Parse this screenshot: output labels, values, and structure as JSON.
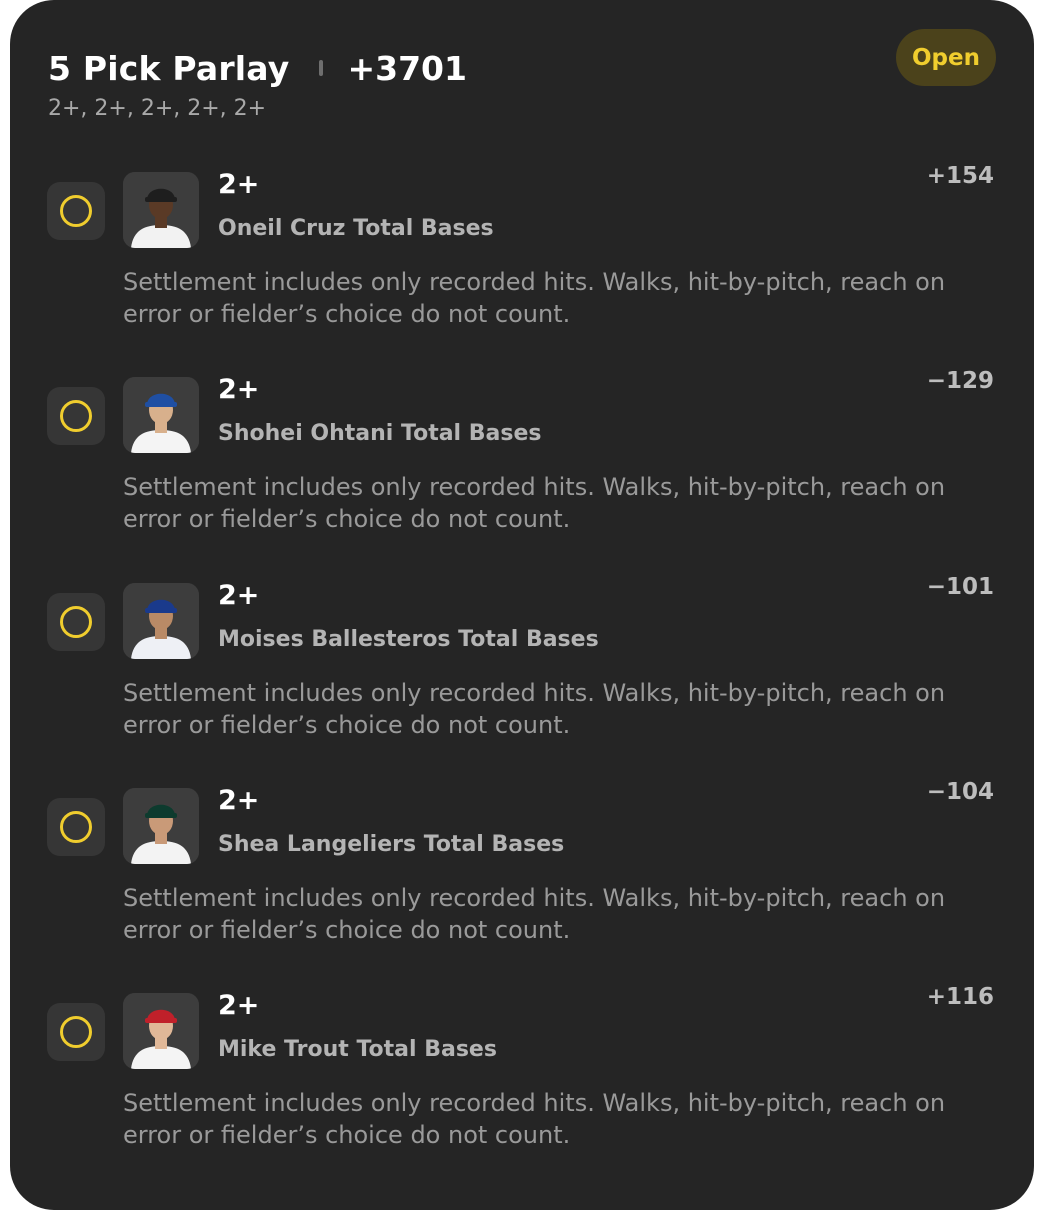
{
  "parlay": {
    "title": "5 Pick Parlay",
    "odds": "+3701",
    "lines_summary": "2+, 2+, 2+, 2+, 2+",
    "status": "Open"
  },
  "picks": [
    {
      "line": "2+",
      "market": "Oneil Cruz Total Bases",
      "odds": "+154",
      "description": "Settlement includes only recorded hits. Walks, hit-by-pitch, reach on error or fielder’s choice do not count.",
      "cap_color": "#1e1e1e",
      "jersey_color": "#f2f2f2",
      "skin_color": "#5a3a26"
    },
    {
      "line": "2+",
      "market": "Shohei Ohtani Total Bases",
      "odds": "−129",
      "description": "Settlement includes only recorded hits. Walks, hit-by-pitch, reach on error or fielder’s choice do not count.",
      "cap_color": "#1f4fa3",
      "jersey_color": "#f4f4f4",
      "skin_color": "#d8b08c"
    },
    {
      "line": "2+",
      "market": "Moises Ballesteros Total Bases",
      "odds": "−101",
      "description": "Settlement includes only recorded hits. Walks, hit-by-pitch, reach on error or fielder’s choice do not count.",
      "cap_color": "#1a3a8c",
      "jersey_color": "#eef0f5",
      "skin_color": "#b98a66"
    },
    {
      "line": "2+",
      "market": "Shea Langeliers Total Bases",
      "odds": "−104",
      "description": "Settlement includes only recorded hits. Walks, hit-by-pitch, reach on error or fielder’s choice do not count.",
      "cap_color": "#0d3b2e",
      "jersey_color": "#f3f3f3",
      "skin_color": "#c99a78"
    },
    {
      "line": "2+",
      "market": "Mike Trout Total Bases",
      "odds": "+116",
      "description": "Settlement includes only recorded hits. Walks, hit-by-pitch, reach on error or fielder’s choice do not count.",
      "cap_color": "#c0202a",
      "jersey_color": "#f4f4f4",
      "skin_color": "#e0b898"
    }
  ]
}
